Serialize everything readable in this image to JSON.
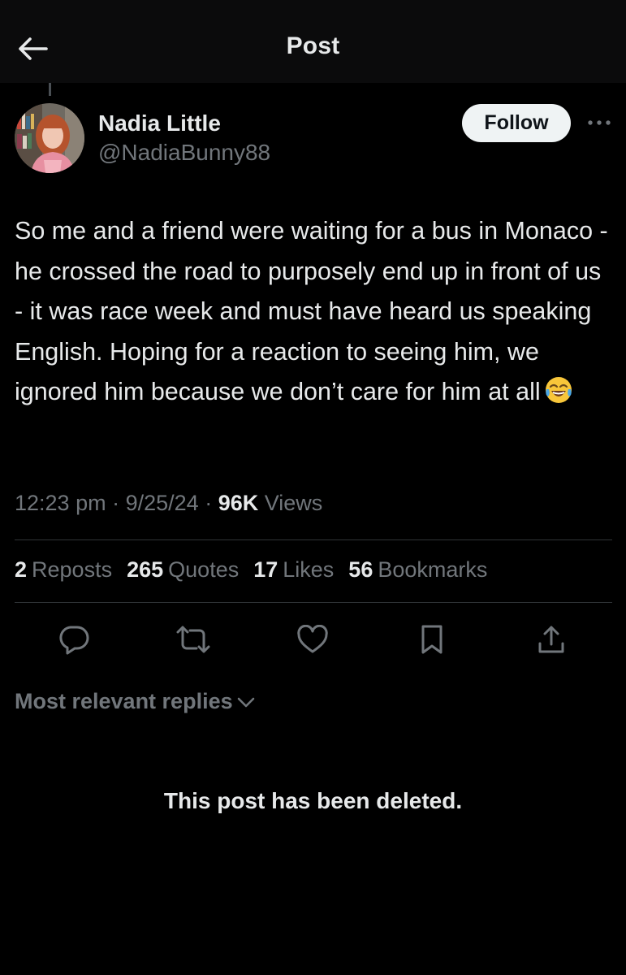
{
  "header": {
    "title": "Post",
    "back_icon": "arrow-left-icon"
  },
  "author": {
    "name": "Nadia Little",
    "handle": "@NadiaBunny88",
    "follow_label": "Follow",
    "more_icon": "more-horizontal-icon"
  },
  "post": {
    "text": "So me and a friend were waiting for a bus in Monaco - he crossed the road to purposely end up in front of us - it was race week and must have heard us speaking English. Hoping for a reaction to seeing him, we ignored him because we don’t care for him at all",
    "emoji": "face-with-tears-of-joy-emoji",
    "time": "12:23 pm",
    "date": "9/25/24",
    "views_count": "96K",
    "views_label": "Views"
  },
  "stats": [
    {
      "count": "2",
      "label": "Reposts"
    },
    {
      "count": "265",
      "label": "Quotes"
    },
    {
      "count": "17",
      "label": "Likes"
    },
    {
      "count": "56",
      "label": "Bookmarks"
    }
  ],
  "actions": [
    "reply-icon",
    "repost-icon",
    "like-icon",
    "bookmark-icon",
    "share-icon"
  ],
  "replies": {
    "sort_label": "Most relevant replies",
    "deleted_message": "This post has been deleted."
  },
  "colors": {
    "background": "#000000",
    "header_bg": "#0b0b0c",
    "text_primary": "#e7e9ea",
    "text_secondary": "#71767b",
    "divider": "#2f3336",
    "follow_bg": "#eff3f4"
  }
}
